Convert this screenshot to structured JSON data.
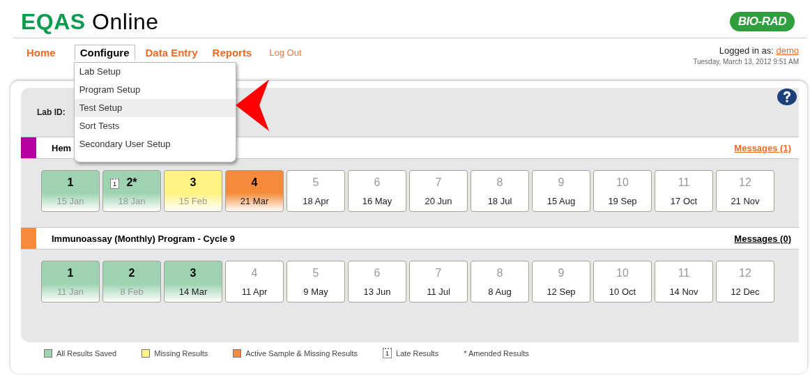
{
  "header": {
    "logo_bold": "EQAS",
    "logo_rest": "Online",
    "brand": "BIO-RAD"
  },
  "nav": [
    {
      "label": "Home",
      "selected": false,
      "kind": "main"
    },
    {
      "label": "Configure",
      "selected": true,
      "kind": "main"
    },
    {
      "label": "Data Entry",
      "selected": false,
      "kind": "main"
    },
    {
      "label": "Reports",
      "selected": false,
      "kind": "main"
    },
    {
      "label": "Log Out",
      "selected": false,
      "kind": "minor"
    }
  ],
  "menu": [
    {
      "label": "Lab Setup",
      "selected": false
    },
    {
      "label": "Program Setup",
      "selected": false
    },
    {
      "label": "Test Setup",
      "selected": true
    },
    {
      "label": "Sort Tests",
      "selected": false
    },
    {
      "label": "Secondary User Setup",
      "selected": false
    }
  ],
  "user": {
    "prefix": "Logged in as:",
    "name": "demo",
    "date": "Tuesday, March 13, 2012 9:51 AM"
  },
  "lab_label": "Lab ID:",
  "programs": [
    {
      "title": "Hem",
      "color": "#b5009f",
      "messages": "Messages (1)",
      "messages_alert": true,
      "samples": [
        {
          "number": "1",
          "date": "15 Jan",
          "color": "#9dd3b0",
          "date_greyed": true
        },
        {
          "number": "2*",
          "date": "18 Jan",
          "color": "#9dd3b0",
          "date_greyed": true,
          "late_icon": "1"
        },
        {
          "number": "3",
          "date": "15 Feb",
          "color": "#fff384",
          "date_greyed": true
        },
        {
          "number": "4",
          "date": "21 Mar",
          "color": "#f48a3a",
          "date_greyed": false
        },
        {
          "number": "5",
          "date": "18 Apr",
          "color": "#ffffff",
          "date_greyed": false
        },
        {
          "number": "6",
          "date": "16 May",
          "color": "#ffffff",
          "date_greyed": false
        },
        {
          "number": "7",
          "date": "20 Jun",
          "color": "#ffffff",
          "date_greyed": false
        },
        {
          "number": "8",
          "date": "18 Jul",
          "color": "#ffffff",
          "date_greyed": false
        },
        {
          "number": "9",
          "date": "15 Aug",
          "color": "#ffffff",
          "date_greyed": false
        },
        {
          "number": "10",
          "date": "19 Sep",
          "color": "#ffffff",
          "date_greyed": false
        },
        {
          "number": "11",
          "date": "17 Oct",
          "color": "#ffffff",
          "date_greyed": false
        },
        {
          "number": "12",
          "date": "21 Nov",
          "color": "#ffffff",
          "date_greyed": false
        }
      ]
    },
    {
      "title": "Immunoassay (Monthly) Program - Cycle 9",
      "color": "#f48a3a",
      "messages": "Messages (0)",
      "messages_alert": false,
      "samples": [
        {
          "number": "1",
          "date": "11 Jan",
          "color": "#9dd3b0",
          "date_greyed": true
        },
        {
          "number": "2",
          "date": "8 Feb",
          "color": "#9dd3b0",
          "date_greyed": true
        },
        {
          "number": "3",
          "date": "14 Mar",
          "color": "#9dd3b0",
          "date_greyed": false
        },
        {
          "number": "4",
          "date": "11 Apr",
          "color": "#ffffff",
          "date_greyed": false
        },
        {
          "number": "5",
          "date": "9 May",
          "color": "#ffffff",
          "date_greyed": false
        },
        {
          "number": "6",
          "date": "13 Jun",
          "color": "#ffffff",
          "date_greyed": false
        },
        {
          "number": "7",
          "date": "11 Jul",
          "color": "#ffffff",
          "date_greyed": false
        },
        {
          "number": "8",
          "date": "8 Aug",
          "color": "#ffffff",
          "date_greyed": false
        },
        {
          "number": "9",
          "date": "12 Sep",
          "color": "#ffffff",
          "date_greyed": false
        },
        {
          "number": "10",
          "date": "10 Oct",
          "color": "#ffffff",
          "date_greyed": false
        },
        {
          "number": "11",
          "date": "14 Nov",
          "color": "#ffffff",
          "date_greyed": false
        },
        {
          "number": "12",
          "date": "12 Dec",
          "color": "#ffffff",
          "date_greyed": false
        }
      ]
    }
  ],
  "legend": [
    {
      "kind": "swatch",
      "color": "#9dd3b0",
      "label": "All Results Saved"
    },
    {
      "kind": "swatch",
      "color": "#fff384",
      "label": "Missing Results"
    },
    {
      "kind": "swatch",
      "color": "#f48a3a",
      "label": "Active Sample & Missing Results"
    },
    {
      "kind": "late",
      "icon": "1",
      "label": "Late Results"
    },
    {
      "kind": "text",
      "label": "* Amended Results"
    }
  ]
}
